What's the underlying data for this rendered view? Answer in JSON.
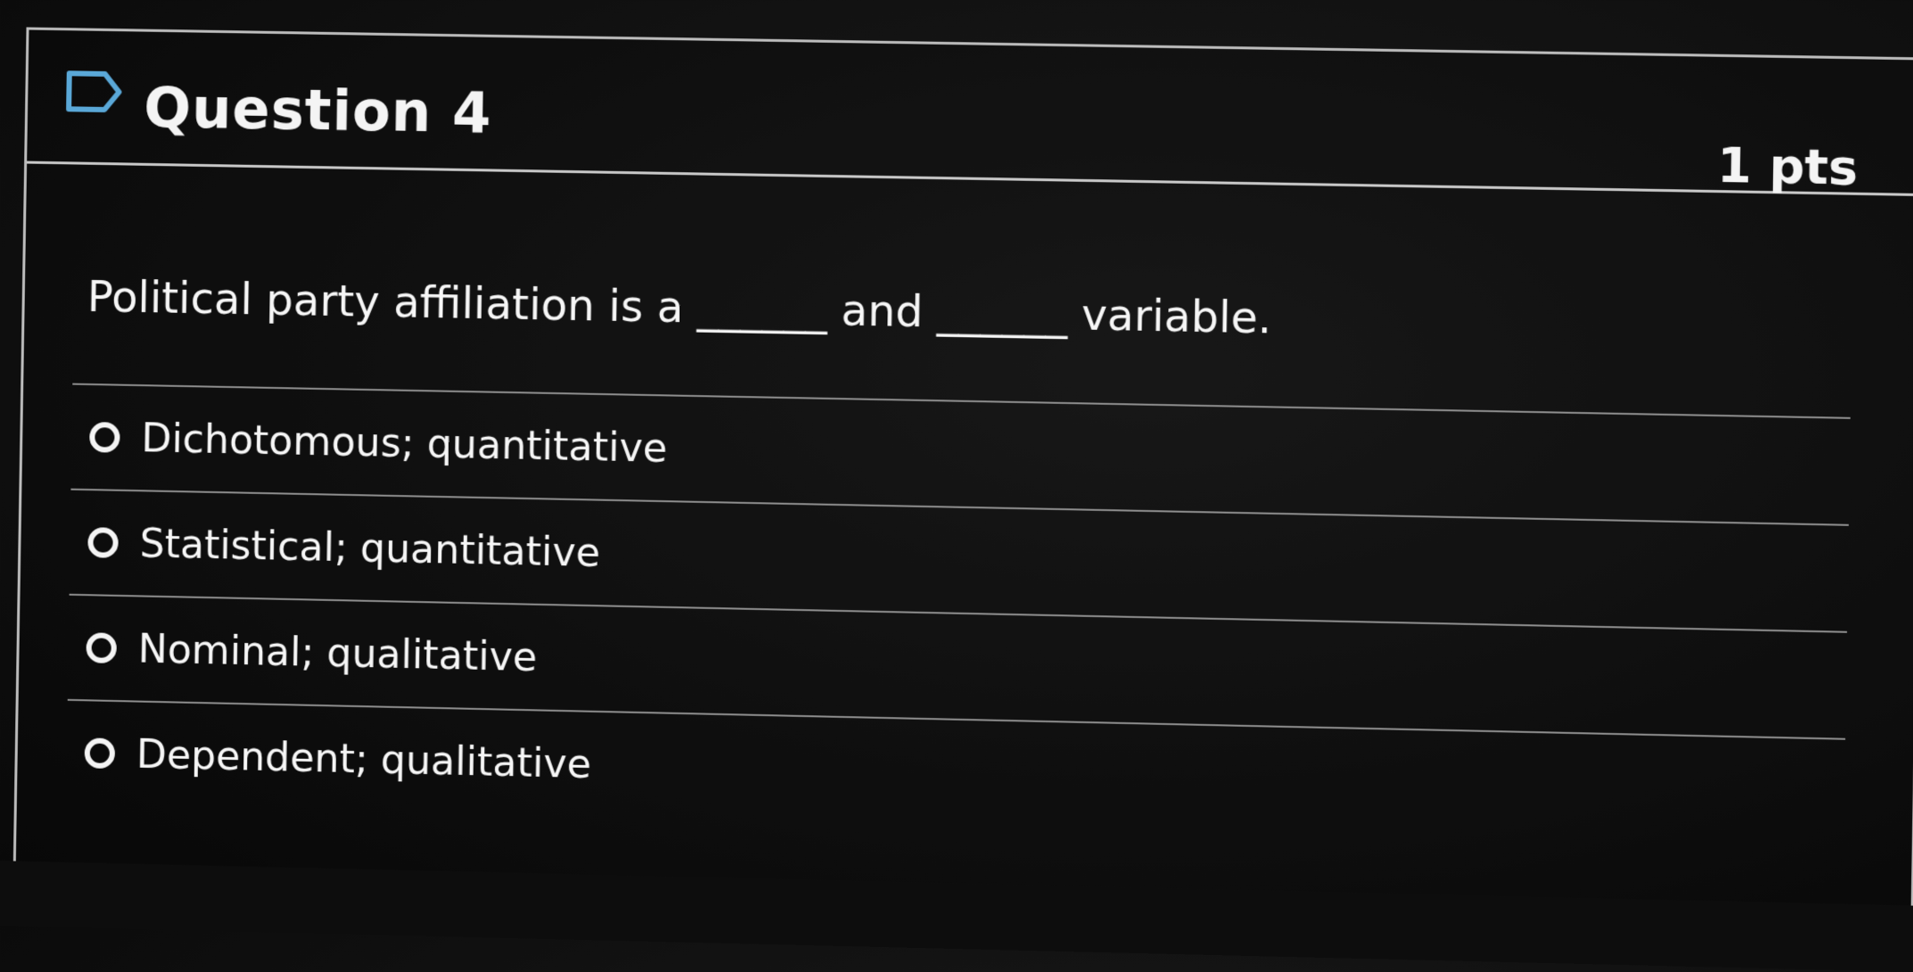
{
  "header": {
    "title": "Question 4",
    "points": "1 pts"
  },
  "question": {
    "text": "Political party affiliation is a ______ and ______ variable."
  },
  "answers": [
    {
      "label": "Dichotomous; quantitative"
    },
    {
      "label": "Statistical; quantitative"
    },
    {
      "label": "Nominal; qualitative"
    },
    {
      "label": "Dependent; qualitative"
    }
  ],
  "icons": {
    "flag": "bookmark-flag-icon",
    "option": "radio-circle-icon"
  },
  "colors": {
    "background": "#111111",
    "text": "#f4f4f4",
    "divider": "#c9c9c9",
    "flag_icon": "#5aa8d8"
  }
}
